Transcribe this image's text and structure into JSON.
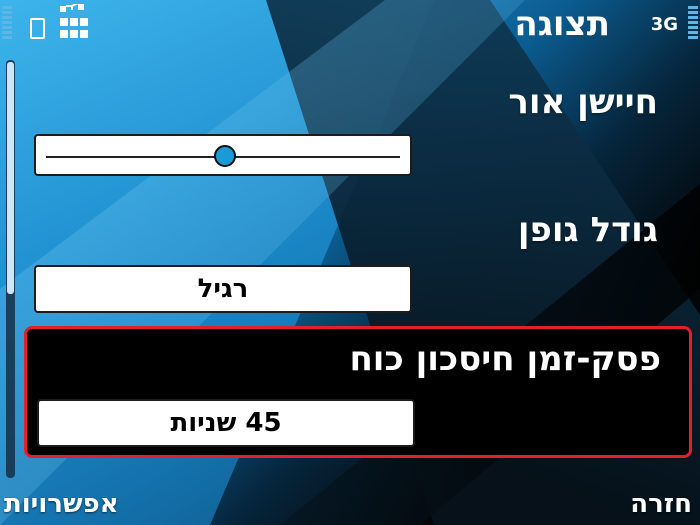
{
  "status_bar": {
    "title": "תצוגה",
    "network": "3G",
    "signal_level": 1.0,
    "battery_level": 1.0,
    "icons": [
      "signal-bars-icon",
      "sim-icon",
      "usb-connection-icon",
      "battery-bars-icon"
    ]
  },
  "settings": {
    "light_sensor": {
      "label": "חיישן אור",
      "value": 0.5
    },
    "font_size": {
      "label": "גודל גופן",
      "value": "רגיל"
    },
    "power_saver_timeout": {
      "label": "פסק-זמן חיסכון כוח",
      "value": "45 שניות",
      "selected": true
    }
  },
  "softkeys": {
    "left": "אפשרויות",
    "right": "חזרה"
  },
  "scrollbar": {
    "position": 0.0,
    "visible_fraction": 0.55
  },
  "colors": {
    "accent": "#1a9ad6",
    "selection_border": "#e0202a",
    "status_icons": "#5fb6e6"
  }
}
